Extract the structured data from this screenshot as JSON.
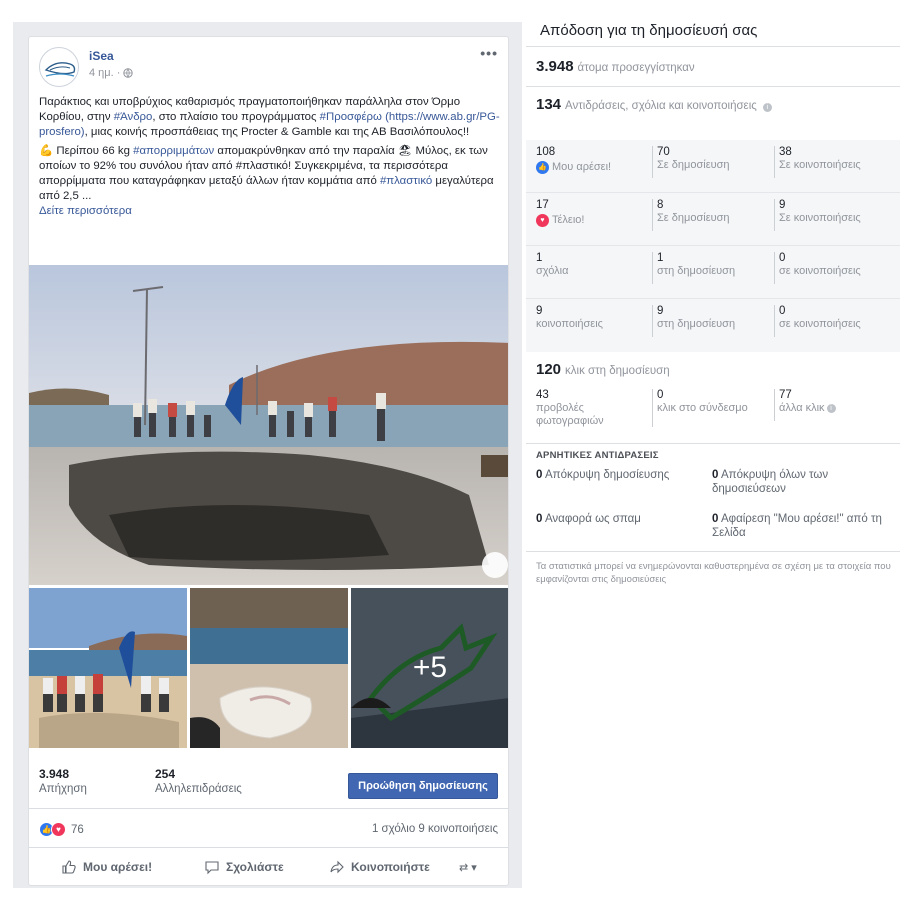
{
  "post": {
    "page_name": "iSea",
    "time": "4 ημ. ·",
    "more": "•••",
    "paragraph1": {
      "t1": "Παράκτιος και υποβρύχιος καθαρισμός πραγματοποιήθηκαν παράλληλα στον Όρμο Κορθίου, στην ",
      "h1": "#Άνδρο",
      "t2": ", στο πλαίσιο του προγράμματος ",
      "h2": "#Προσφέρω (https://www.ab.gr/PG-prosfero)",
      "t3": ", μιας κοινής προσπάθειας της Procter & Gamble και της ΑΒ Βασιλόπουλος!!"
    },
    "paragraph2": {
      "emoji": "💪",
      "t1": " Περίπου 66 kg ",
      "h1": "#απορριμμάτων",
      "t2": " απομακρύνθηκαν από την παραλία ",
      "emoji2": "🏖",
      "t3": " Μύλος, εκ των οποίων το 92% του συνόλου ήταν από #πλαστικό! Συγκεκριμένα, τα περισσότερα απορρίμματα που καταγράφηκαν μεταξύ άλλων ήταν κομμάτια από ",
      "h2": "#πλαστικό",
      "t4": " μεγαλύτερα από 2,5 ..."
    },
    "see_more": "Δείτε περισσότερα",
    "more_photos": "+5",
    "reach_value": "3.948",
    "reach_label": "Απήχηση",
    "engagement_value": "254",
    "engagement_label": "Αλληλεπιδράσεις",
    "boost_label": "Προώθηση δημοσίευσης",
    "reactions_count": "76",
    "comments_shares": "1 σχόλιο  9 κοινοποιήσεις",
    "actions": {
      "like": "Μου αρέσει!",
      "comment": "Σχολιάστε",
      "share": "Κοινοποιήστε"
    }
  },
  "panel": {
    "title": "Απόδοση για τη δημοσίευσή σας",
    "people_reached_value": "3.948",
    "people_reached_label": "άτομα προσεγγίστηκαν",
    "reactions_value": "134",
    "reactions_label": "Αντιδράσεις, σχόλια και κοινοποιήσεις",
    "rows": [
      {
        "c1n": "108",
        "c1l": "Μου αρέσει!",
        "c2n": "70",
        "c2l": "Σε δημοσίευση",
        "c3n": "38",
        "c3l": "Σε κοινοποιήσεις"
      },
      {
        "c1n": "17",
        "c1l": "Τέλειο!",
        "c2n": "8",
        "c2l": "Σε δημοσίευση",
        "c3n": "9",
        "c3l": "Σε κοινοποιήσεις"
      },
      {
        "c1n": "1",
        "c1l": "σχόλια",
        "c2n": "1",
        "c2l": "στη δημοσίευση",
        "c3n": "0",
        "c3l": "σε κοινοποιήσεις"
      },
      {
        "c1n": "9",
        "c1l": "κοινοποιήσεις",
        "c2n": "9",
        "c2l": "στη δημοσίευση",
        "c3n": "0",
        "c3l": "σε κοινοποιήσεις"
      }
    ],
    "clicks_value": "120",
    "clicks_label": "κλικ στη δημοσίευση",
    "clicks": {
      "photo_n": "43",
      "photo_l": "προβολές φωτογραφιών",
      "link_n": "0",
      "link_l": "κλικ στο σύνδεσμο",
      "other_n": "77",
      "other_l": "άλλα κλικ"
    },
    "negative_title": "ΑΡΝΗΤΙΚΕΣ ΑΝΤΙΔΡΑΣΕΙΣ",
    "negative": {
      "hide_post_n": "0",
      "hide_post_l": "Απόκρυψη δημοσίευσης",
      "hide_all_n": "0",
      "hide_all_l": "Απόκρυψη όλων των δημοσιεύσεων",
      "spam_n": "0",
      "spam_l": "Αναφορά ως σπαμ",
      "unlike_n": "0",
      "unlike_l": "Αφαίρεση \"Μου αρέσει!\" από τη Σελίδα"
    },
    "footnote": "Τα στατιστικά μπορεί να ενημερώνονται καθυστερημένα σε σχέση με τα στοιχεία που εμφανίζονται στις δημοσιεύσεις"
  }
}
